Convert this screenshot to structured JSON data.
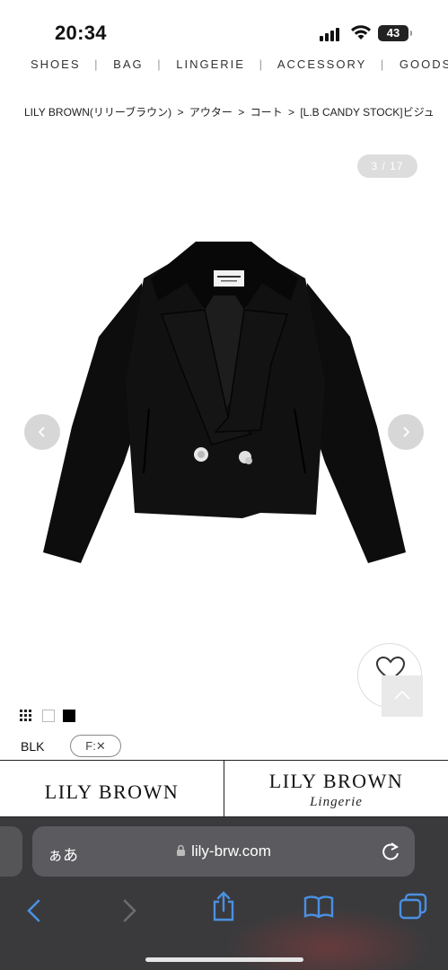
{
  "status_bar": {
    "time": "20:34",
    "battery": "43"
  },
  "category_nav": {
    "items": [
      "SHOES",
      "BAG",
      "LINGERIE",
      "ACCESSORY",
      "GOODS"
    ],
    "separator": "|"
  },
  "breadcrumb": {
    "items": [
      "LILY BROWN(リリーブラウン)",
      ">",
      "アウター",
      ">",
      "コート",
      ">",
      "[L.B CANDY STOCK]ビジュ"
    ]
  },
  "gallery": {
    "counter": "3 / 17"
  },
  "product": {
    "color_label": "BLK",
    "size_label": "F:✕",
    "swatches": [
      "pattern",
      "white",
      "black"
    ]
  },
  "brands": {
    "left": "LILY BROWN",
    "right_title": "LILY BROWN",
    "right_sub": "Lingerie"
  },
  "safari": {
    "aa_label": "ぁあ",
    "url": "lily-brw.com"
  },
  "colors": {
    "toolbar_bg": "#3a3a3c",
    "address_bg": "#5b5b5f",
    "accent_blue": "#4a90e2"
  },
  "icons": [
    "signal-icon",
    "wifi-icon",
    "battery-icon",
    "chevron-left-icon",
    "chevron-right-icon",
    "heart-icon",
    "chevron-up-icon",
    "lock-icon",
    "reload-icon",
    "back-icon",
    "forward-icon",
    "share-icon",
    "bookmarks-icon",
    "tabs-icon"
  ]
}
